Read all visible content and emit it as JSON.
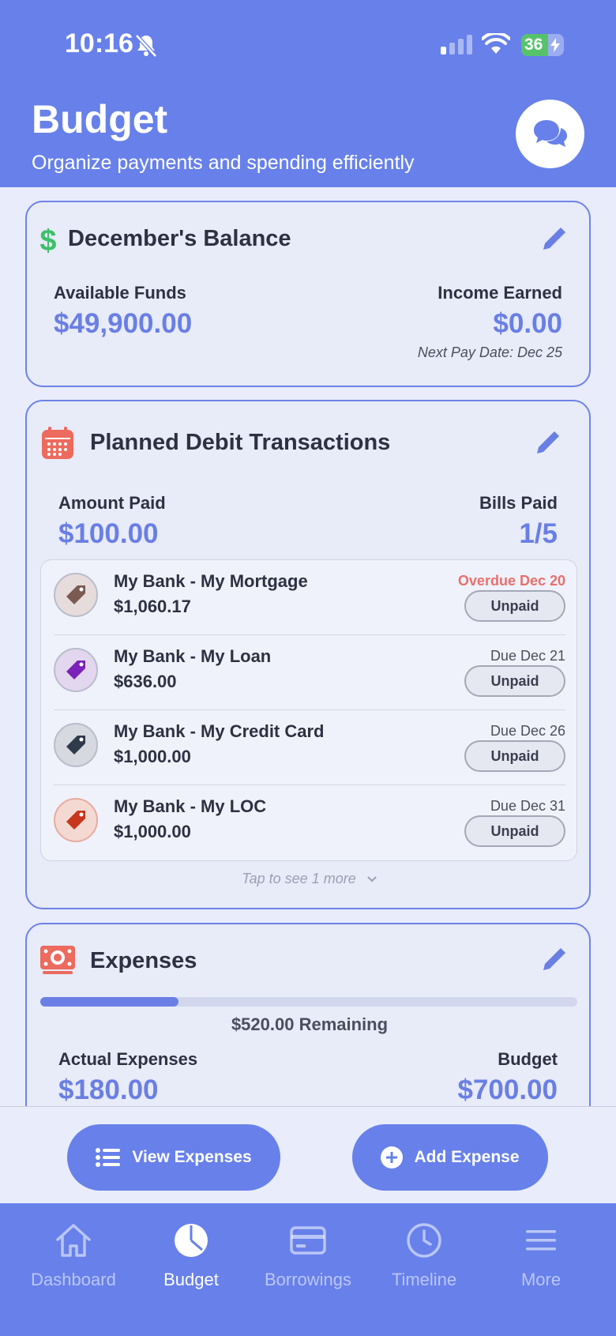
{
  "status_bar": {
    "time": "10:16",
    "battery": "36"
  },
  "header": {
    "title": "Budget",
    "subtitle": "Organize payments and spending efficiently",
    "chat_icon": "chat-bubbles-icon"
  },
  "balance_card": {
    "title": "December's Balance",
    "available_label": "Available Funds",
    "available_value": "$49,900.00",
    "income_label": "Income Earned",
    "income_value": "$0.00",
    "next_pay": "Next Pay Date: Dec 25"
  },
  "planned_card": {
    "title": "Planned Debit Transactions",
    "amount_paid_label": "Amount Paid",
    "amount_paid_value": "$100.00",
    "bills_paid_label": "Bills Paid",
    "bills_paid_value": "1/5",
    "bills": [
      {
        "name": "My Bank - My Mortgage",
        "amount": "$1,060.17",
        "due": "Overdue Dec 20",
        "status": "Unpaid",
        "tag_color": "#7a5a52"
      },
      {
        "name": "My Bank - My Loan",
        "amount": "$636.00",
        "due": "Due Dec 21",
        "status": "Unpaid",
        "tag_color": "#7b22b8"
      },
      {
        "name": "My Bank - My Credit Card",
        "amount": "$1,000.00",
        "due": "Due Dec 26",
        "status": "Unpaid",
        "tag_color": "#2f3a4a"
      },
      {
        "name": "My Bank - My LOC",
        "amount": "$1,000.00",
        "due": "Due Dec 31",
        "status": "Unpaid",
        "tag_color": "#c8361c"
      }
    ],
    "more_text": "Tap to see 1 more"
  },
  "expenses_card": {
    "title": "Expenses",
    "progress_fraction": 0.257,
    "remaining": "$520.00 Remaining",
    "actual_label": "Actual Expenses",
    "actual_value": "$180.00",
    "budget_label": "Budget",
    "budget_value": "$700.00"
  },
  "actions": {
    "view_label": "View Expenses",
    "add_label": "Add Expense"
  },
  "tabs": [
    {
      "label": "Dashboard",
      "icon": "home-icon"
    },
    {
      "label": "Budget",
      "icon": "pie-chart-icon"
    },
    {
      "label": "Borrowings",
      "icon": "credit-card-icon"
    },
    {
      "label": "Timeline",
      "icon": "clock-icon"
    },
    {
      "label": "More",
      "icon": "menu-icon"
    }
  ],
  "colors": {
    "accent": "#6780ea",
    "value": "#6a7fe4",
    "overdue": "#e8706c",
    "dollar_green": "#3fbf6a",
    "calendar_red": "#ec6a5e"
  }
}
